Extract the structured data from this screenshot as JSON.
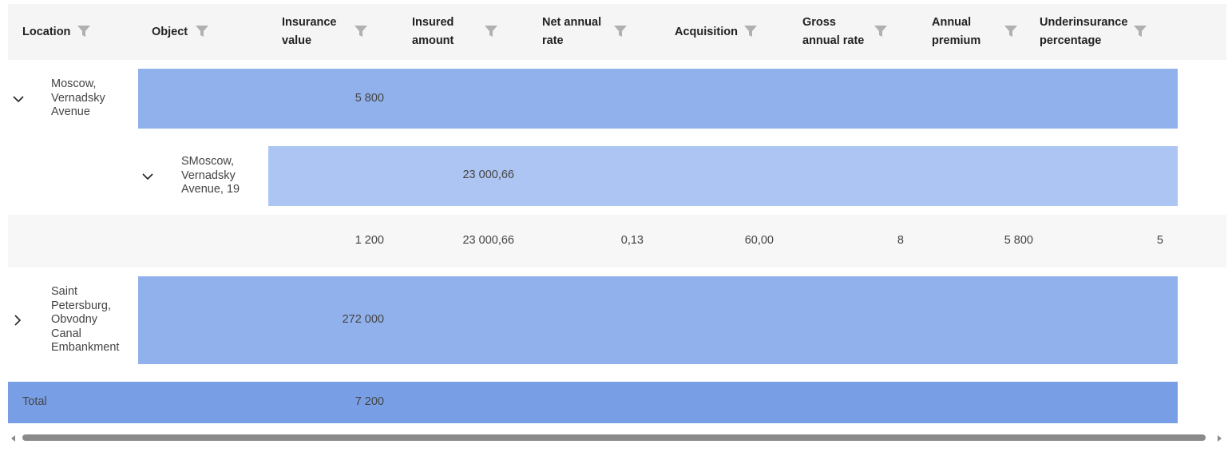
{
  "colors": {
    "header_bg": "#f5f5f5",
    "group_band": "#91b1ec",
    "subgroup_band": "#adc5f2",
    "detail_row_bg": "#f7f7f7",
    "total_band": "#789fe6",
    "filter_icon": "#b0b0b0",
    "scroll_thumb": "#8a8a8a"
  },
  "columns": [
    {
      "label": "Location",
      "icon": "filter-icon"
    },
    {
      "label": "Object",
      "icon": "filter-icon"
    },
    {
      "label": "Insurance\nvalue",
      "icon": "filter-icon"
    },
    {
      "label": "Insured\namount",
      "icon": "filter-icon"
    },
    {
      "label": "Net annual\nrate",
      "icon": "filter-icon"
    },
    {
      "label": "Acquisition",
      "icon": "filter-icon"
    },
    {
      "label": "Gross\nannual rate",
      "icon": "filter-icon"
    },
    {
      "label": "Annual\npremium",
      "icon": "filter-icon"
    },
    {
      "label": "Underinsurance\npercentage",
      "icon": "filter-icon"
    }
  ],
  "rows": {
    "group1": {
      "expanded_icon": "chevron-down-icon",
      "location": "Moscow,\nVernadsky\nAvenue",
      "insurance_value": "5 800"
    },
    "subgroup1": {
      "expanded_icon": "chevron-down-icon",
      "object": "SMoscow,\nVernadsky\nAvenue, 19",
      "insured_amount": "23 000,66"
    },
    "detail1": {
      "insurance_value": "1 200",
      "insured_amount": "23 000,66",
      "net_annual_rate": "0,13",
      "acquisition": "60,00",
      "gross_annual_rate": "8",
      "annual_premium": "5 800",
      "underinsurance_percentage": "5"
    },
    "group2": {
      "expanded_icon": "chevron-right-icon",
      "location": "Saint\nPetersburg,\nObvodny\nCanal\nEmbankment",
      "insurance_value": "272 000"
    },
    "total": {
      "label": "Total",
      "insurance_value": "7 200"
    }
  },
  "scrollbar": {
    "left_icon": "scroll-left-icon",
    "right_icon": "scroll-right-icon"
  }
}
